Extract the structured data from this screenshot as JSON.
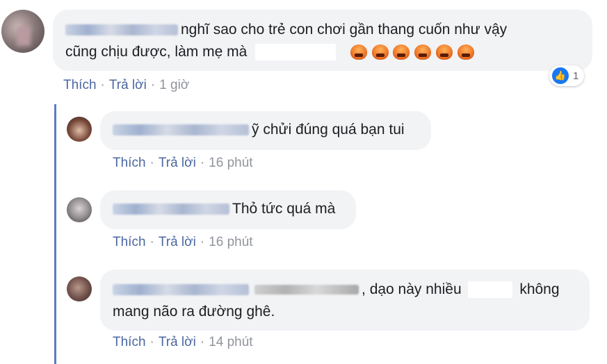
{
  "main_comment": {
    "text_line1": "nghĩ sao cho trẻ con chơi gần thang cuốn như vậy",
    "text_line2": "cũng chịu được, làm mẹ mà",
    "reaction_count": "1",
    "actions": {
      "like": "Thích",
      "reply": "Trả lời",
      "time": "1 giờ"
    }
  },
  "replies": [
    {
      "text": "ỹ chửi đúng quá bạn tui",
      "actions": {
        "like": "Thích",
        "reply": "Trả lời",
        "time": "16 phút"
      }
    },
    {
      "text": "Thỏ tức quá mà",
      "actions": {
        "like": "Thích",
        "reply": "Trả lời",
        "time": "16 phút"
      }
    },
    {
      "text_line1_a": ",",
      "text_line1_b": "dạo này nhiều",
      "text_line1_c": "không",
      "text_line2": "mang não ra đường ghê.",
      "actions": {
        "like": "Thích",
        "reply": "Trả lời",
        "time": "14 phút"
      }
    }
  ],
  "separator": "·",
  "colors": {
    "link": "#4b67a1",
    "bubble": "#f2f3f5",
    "thread_line": "#5b7dbf",
    "like_blue": "#1877f2"
  },
  "icons": {
    "reaction": "like-icon",
    "emoji": "pouting-face-icon"
  }
}
